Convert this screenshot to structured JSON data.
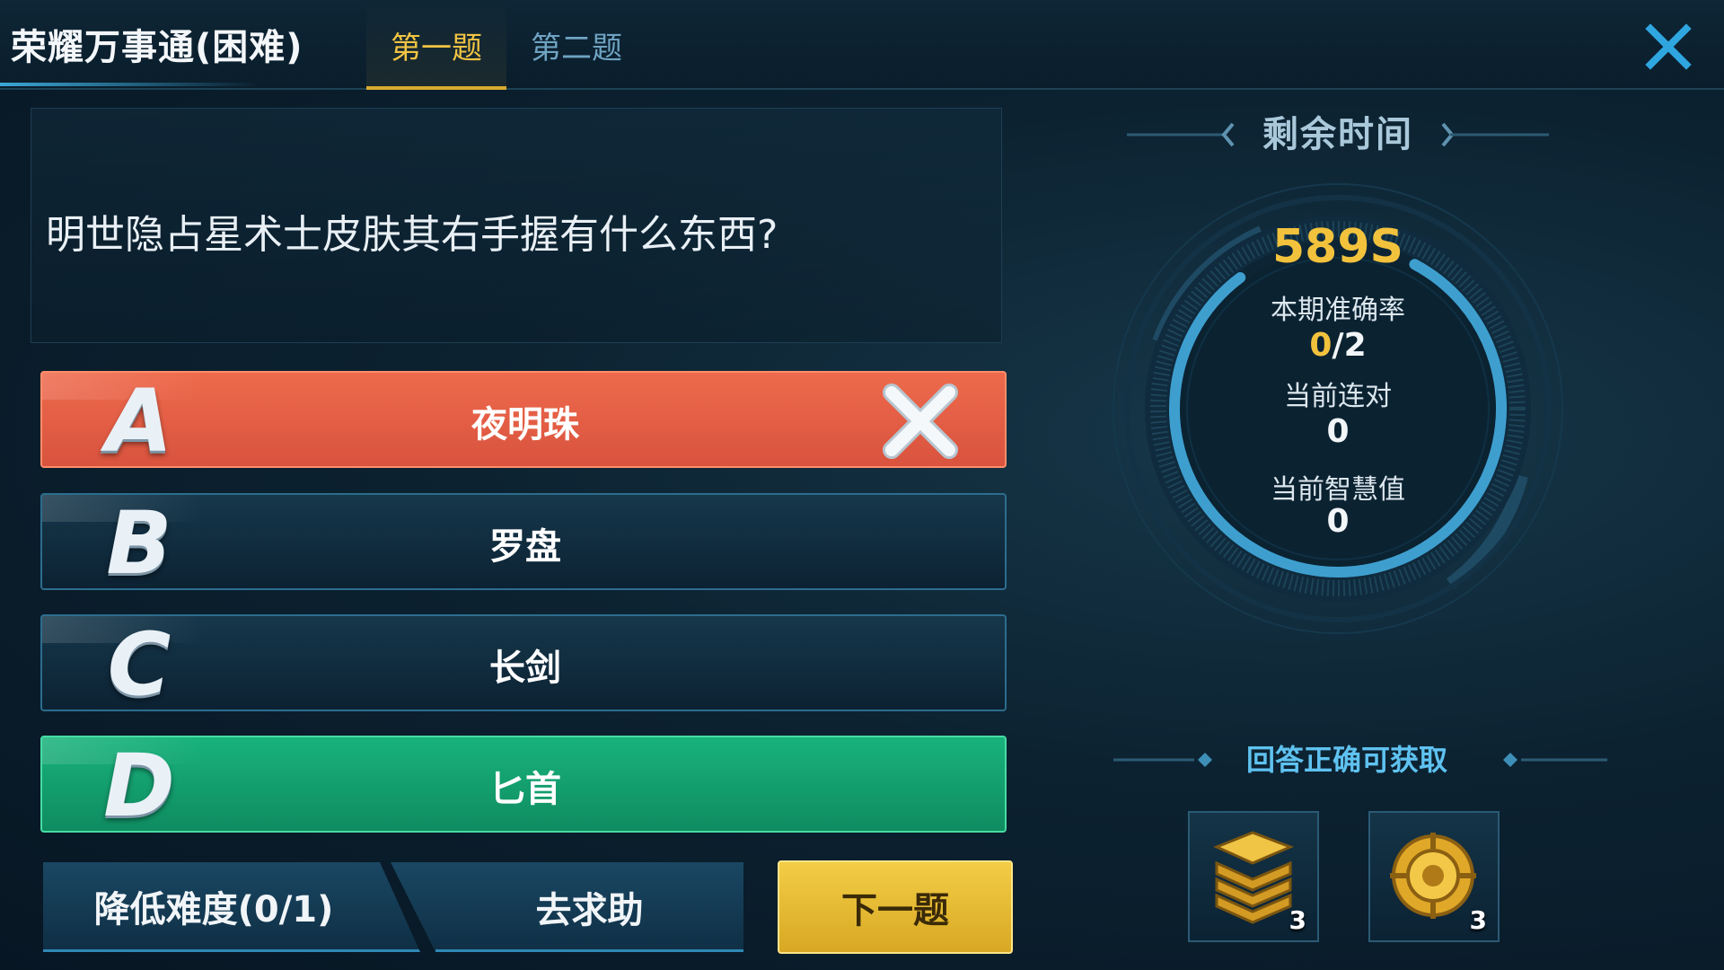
{
  "header": {
    "title": "荣耀万事通(困难)",
    "tabs": [
      {
        "label": "第一题",
        "active": true
      },
      {
        "label": "第二题",
        "active": false
      }
    ]
  },
  "question": {
    "text": "明世隐占星术士皮肤其右手握有什么东西?"
  },
  "options": [
    {
      "letter": "A",
      "label": "夜明珠",
      "state": "wrong"
    },
    {
      "letter": "B",
      "label": "罗盘",
      "state": "normal"
    },
    {
      "letter": "C",
      "label": "长剑",
      "state": "normal"
    },
    {
      "letter": "D",
      "label": "匕首",
      "state": "correct"
    }
  ],
  "buttons": {
    "lower_difficulty": "降低难度(0/1)",
    "ask_help": "去求助",
    "next": "下一题"
  },
  "timer": {
    "title": "剩余时间",
    "remaining": "589S",
    "remaining_fraction": 0.82
  },
  "stats": {
    "accuracy_label": "本期准确率",
    "accuracy_correct": "0",
    "accuracy_total": "/2",
    "streak_label": "当前连对",
    "streak_value": "0",
    "wisdom_label": "当前智慧值",
    "wisdom_value": "0"
  },
  "rewards": {
    "title": "回答正确可获取",
    "items": [
      {
        "icon": "gold-coins-stack-icon",
        "count": "3"
      },
      {
        "icon": "gold-medallion-icon",
        "count": "3"
      }
    ]
  },
  "colors": {
    "accent_gold": "#f2c23d",
    "wrong_red": "#e05d44",
    "correct_green": "#15a472",
    "panel_blue": "#12324a"
  }
}
